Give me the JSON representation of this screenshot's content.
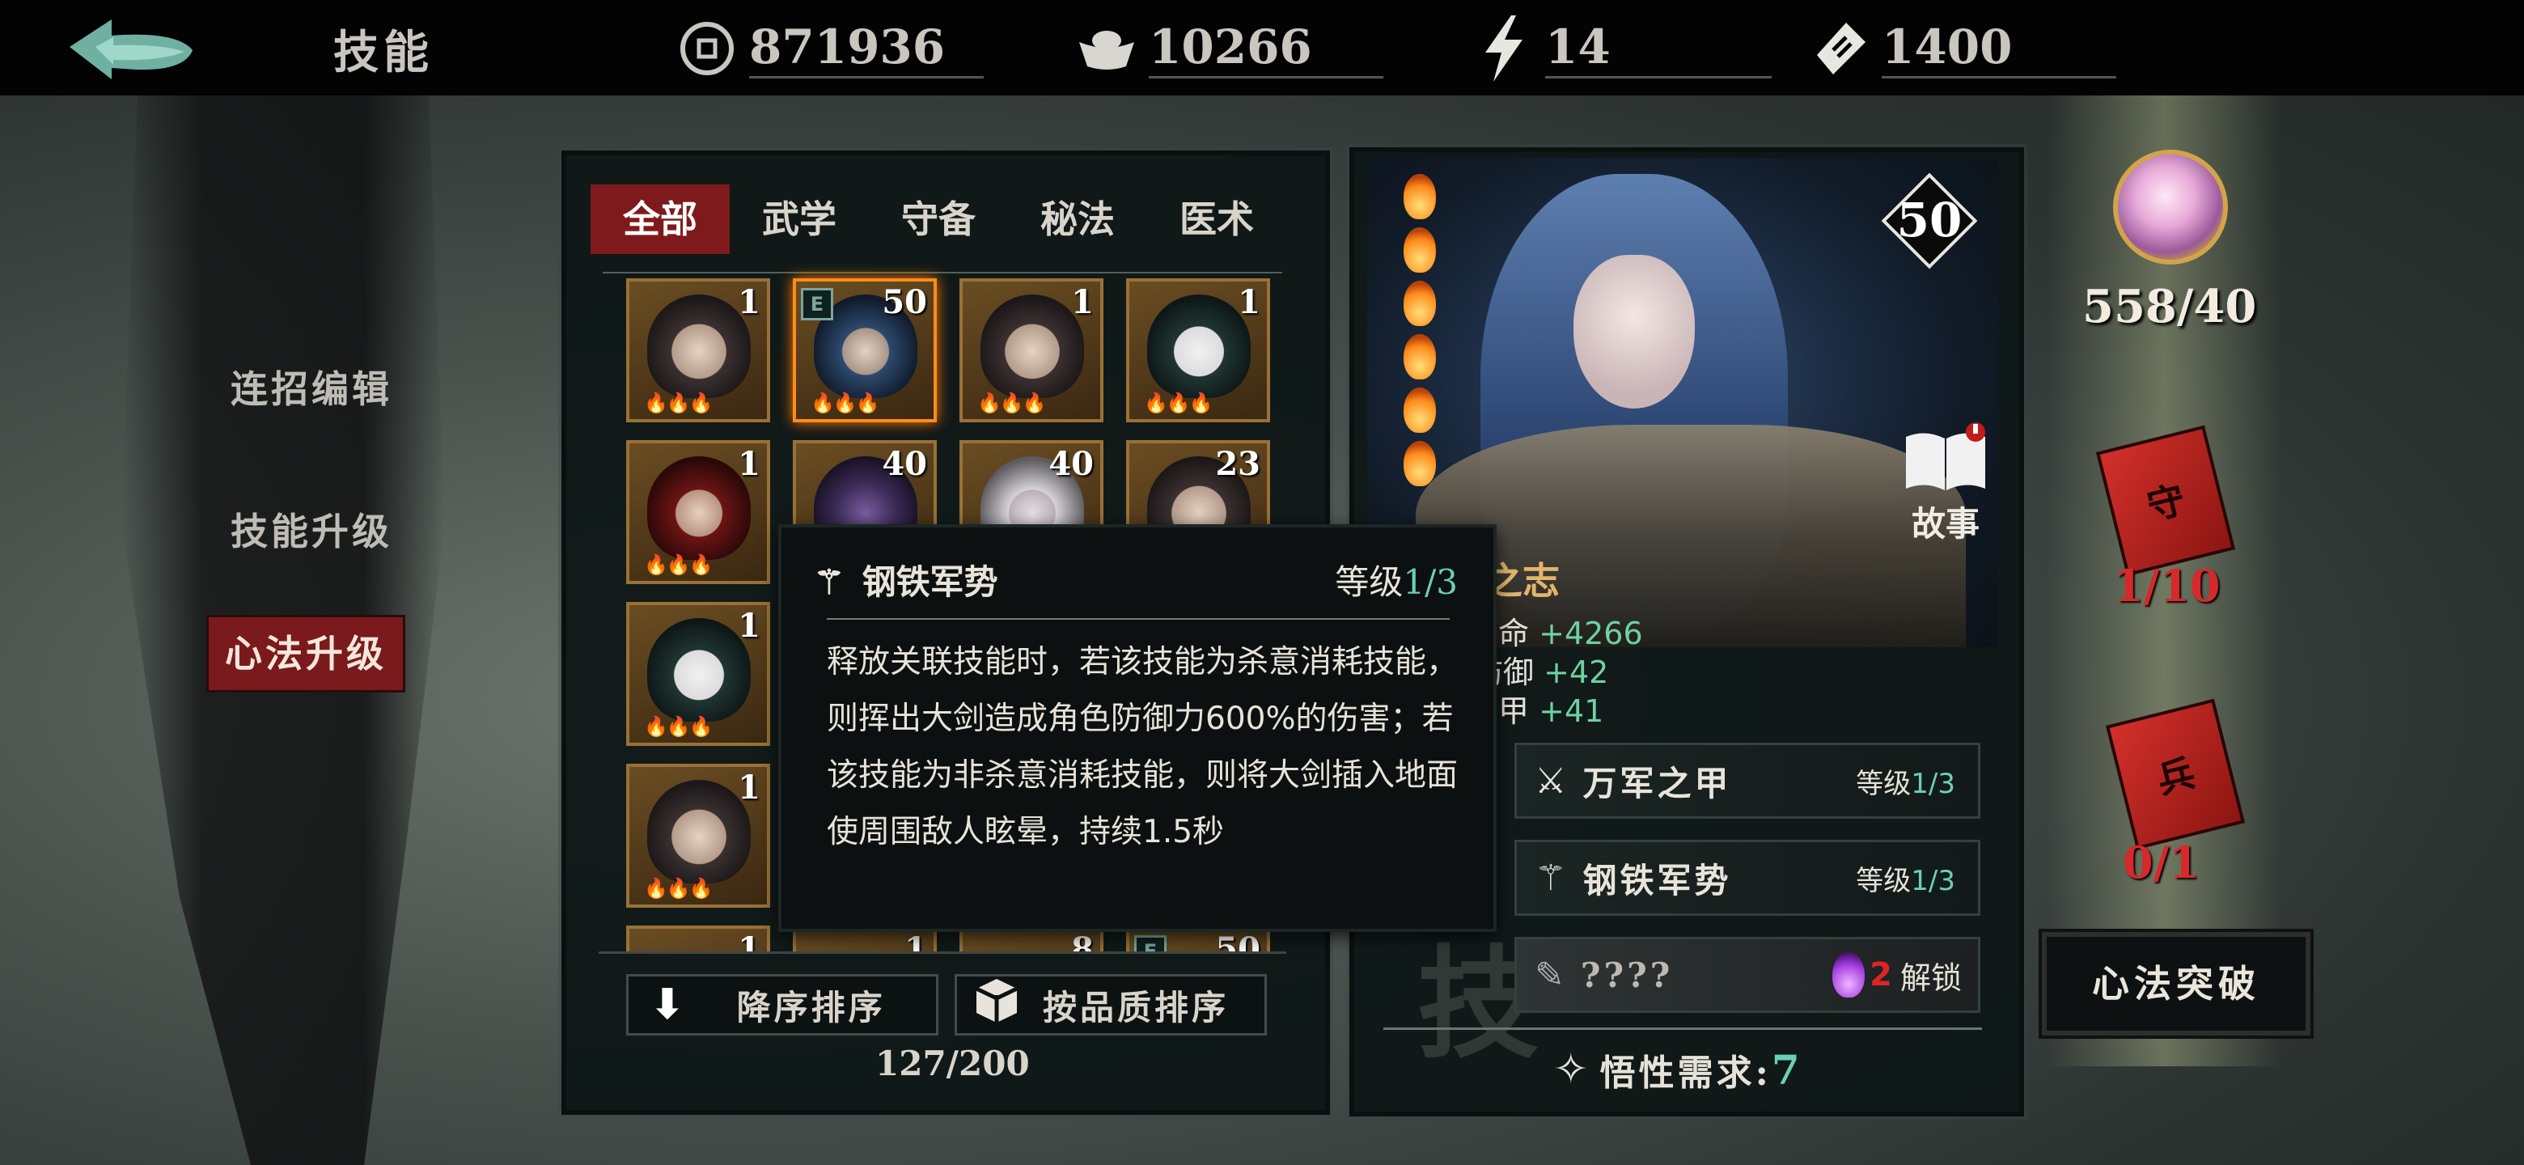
{
  "header": {
    "title": "技能",
    "resources": [
      {
        "icon": "coin-icon",
        "value": "871936"
      },
      {
        "icon": "silver-ingot-icon",
        "value": "10266"
      },
      {
        "icon": "lightning-icon",
        "value": "14"
      },
      {
        "icon": "ticket-icon",
        "value": "1400"
      }
    ]
  },
  "sidebar": {
    "items": [
      {
        "label": "连招编辑",
        "active": false
      },
      {
        "label": "技能升级",
        "active": false
      },
      {
        "label": "心法升级",
        "active": true
      }
    ]
  },
  "tabs": [
    {
      "label": "全部",
      "active": true
    },
    {
      "label": "武学",
      "active": false
    },
    {
      "label": "守备",
      "active": false
    },
    {
      "label": "秘法",
      "active": false
    },
    {
      "label": "医术",
      "active": false
    }
  ],
  "grid": {
    "slots": [
      {
        "level": "1",
        "badge": ""
      },
      {
        "level": "50",
        "badge": "E",
        "selected": true
      },
      {
        "level": "1",
        "badge": ""
      },
      {
        "level": "1",
        "badge": ""
      },
      {
        "level": "1",
        "badge": ""
      },
      {
        "level": "40",
        "badge": ""
      },
      {
        "level": "40",
        "badge": ""
      },
      {
        "level": "23",
        "badge": ""
      },
      {
        "level": "1",
        "badge": ""
      },
      {
        "level": "1",
        "badge": ""
      },
      {
        "level": "1",
        "badge": ""
      },
      {
        "level": "1",
        "badge": ""
      },
      {
        "level": "8",
        "badge": ""
      },
      {
        "level": "50",
        "badge": "E"
      }
    ],
    "count": "127/200"
  },
  "sort": {
    "desc_label": "降序排序",
    "quality_label": "按品质排序"
  },
  "tooltip": {
    "name": "钢铁军势",
    "level_label": "等级",
    "level_value": "1/3",
    "description": "释放关联技能时，若该技能为杀意消耗技能，则挥出大剑造成角色防御力600%的伤害；若该技能为非杀意消耗技能，则将大剑插入地面使周围敌人眩晕，持续1.5秒"
  },
  "detail": {
    "level": "50",
    "story_label": "故事",
    "heart_name": "铭之志",
    "stats": [
      {
        "label": "命",
        "value": "+4266"
      },
      {
        "label": "防御",
        "value": "+42"
      },
      {
        "label": "甲",
        "value": "+41"
      }
    ],
    "skills": [
      {
        "name": "万军之甲",
        "level_label": "等级",
        "level": "1/3"
      },
      {
        "name": "钢铁军势",
        "level_label": "等级",
        "level": "1/3"
      },
      {
        "name": "????",
        "unlock_cost": "2",
        "unlock_label": "解锁"
      }
    ],
    "requirement_label": "悟性需求:",
    "requirement_value": "7",
    "watermark": "技"
  },
  "right": {
    "orb_count": "558/40",
    "book1_char": "守",
    "book1_count": "1/10",
    "book2_char": "兵",
    "book2_count": "0/1",
    "break_button": "心法突破"
  },
  "colors": {
    "accent_red": "#7f1a1c",
    "teal": "#6ccfb8",
    "gold": "#e2b56a"
  }
}
